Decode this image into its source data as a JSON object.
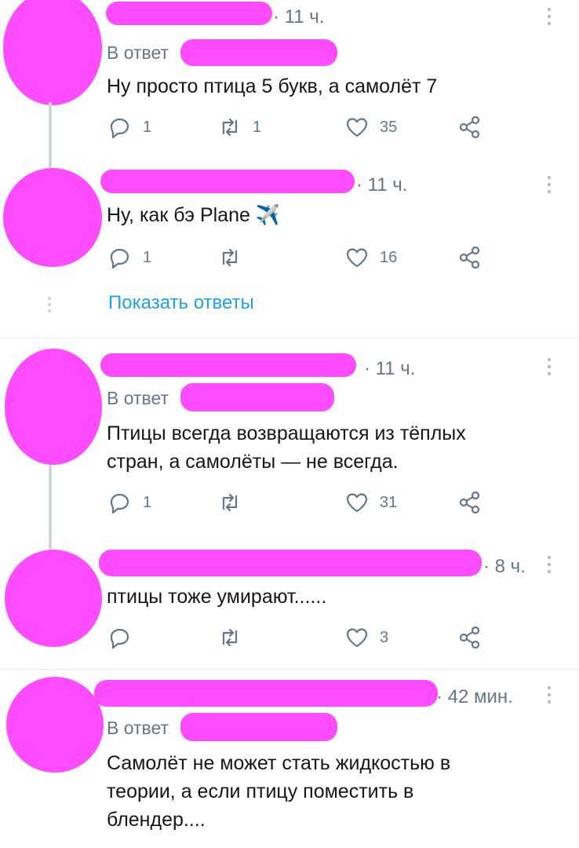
{
  "tweets": [
    {
      "time": "· 11 ч.",
      "reply_to": "В ответ",
      "text": "Ну просто птица 5 букв, а самолёт  7",
      "replies": "1",
      "retweets": "1",
      "likes": "35"
    },
    {
      "time": "· 11 ч.",
      "text": "Ну, как бэ Plane ✈️",
      "replies": "1",
      "retweets": "",
      "likes": "16"
    },
    {
      "time": "· 11 ч.",
      "reply_to": "В ответ",
      "text_line1": "Птицы всегда возвращаются из тёплых",
      "text_line2": "стран, а самолёты — не всегда.",
      "replies": "1",
      "retweets": "",
      "likes": "31"
    },
    {
      "time": "· 8 ч.",
      "text": "птицы тоже умирают......",
      "replies": "",
      "retweets": "",
      "likes": "3"
    },
    {
      "time": "· 42 мин.",
      "reply_to": "В ответ",
      "text_line1": "Самолёт не может стать жидкостью в",
      "text_line2": "теории, а если птицу поместить в",
      "text_line3": "блендер...."
    }
  ],
  "show_replies_label": "Показать ответы",
  "colors": {
    "redaction": "#ff4bff",
    "link": "#1da1f2",
    "muted": "#657786"
  },
  "icons": [
    "reply-icon",
    "retweet-icon",
    "like-icon",
    "share-icon",
    "more-icon"
  ]
}
